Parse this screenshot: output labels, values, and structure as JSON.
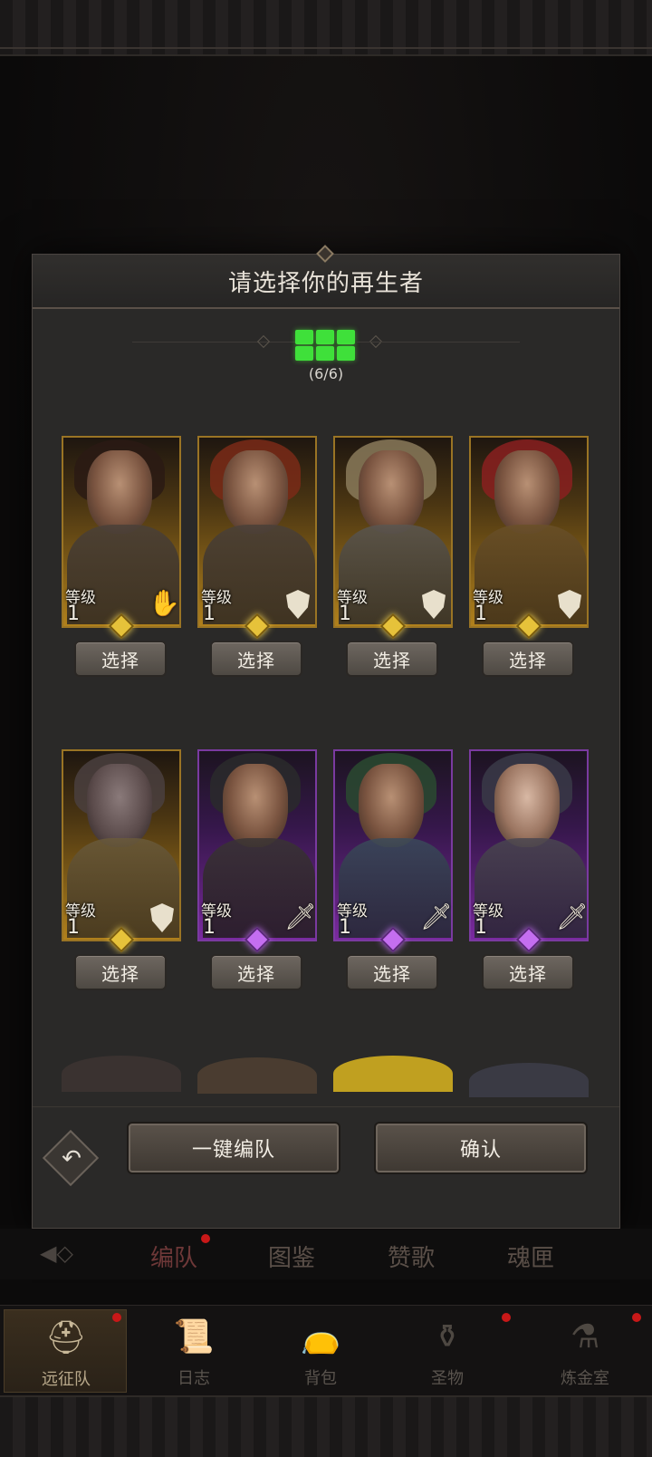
{
  "modal": {
    "title": "请选择你的再生者",
    "party_count": "(6/6)",
    "party_icon": "party-grid-icon"
  },
  "level_label": "等级",
  "select_label": "选择",
  "heroes": [
    {
      "level": "1",
      "rarity": "gold",
      "class_icon": "hand-icon"
    },
    {
      "level": "1",
      "rarity": "gold",
      "class_icon": "shield-icon"
    },
    {
      "level": "1",
      "rarity": "gold",
      "class_icon": "shield-icon"
    },
    {
      "level": "1",
      "rarity": "gold",
      "class_icon": "shield-icon"
    },
    {
      "level": "1",
      "rarity": "gold",
      "class_icon": "shield-icon"
    },
    {
      "level": "1",
      "rarity": "purple",
      "class_icon": "sword-icon"
    },
    {
      "level": "1",
      "rarity": "purple",
      "class_icon": "sword-icon"
    },
    {
      "level": "1",
      "rarity": "purple",
      "class_icon": "sword-icon"
    }
  ],
  "footer": {
    "auto_team_label": "一键编队",
    "confirm_label": "确认",
    "undo_icon": "undo-icon"
  },
  "subtabs": [
    "编队",
    "图鉴",
    "赞歌",
    "魂匣"
  ],
  "bottom_nav": [
    {
      "label": "远征队",
      "icon": "helmet-icon"
    },
    {
      "label": "日志",
      "icon": "scroll-icon"
    },
    {
      "label": "背包",
      "icon": "bag-icon"
    },
    {
      "label": "圣物",
      "icon": "relic-icon"
    },
    {
      "label": "炼金室",
      "icon": "alchemy-icon"
    }
  ],
  "colors": {
    "gold_rarity": "#b0801c",
    "purple_rarity": "#7a2aa0",
    "party_green": "#3fe03a",
    "notification_red": "#c81818"
  }
}
